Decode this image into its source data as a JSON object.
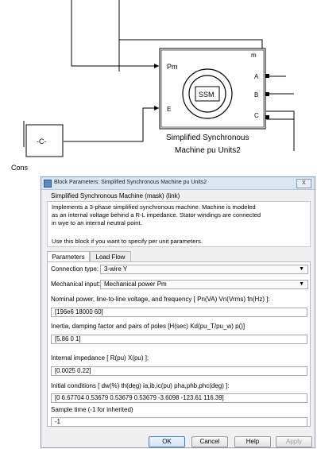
{
  "diagram": {
    "machine_block": {
      "port_labels": {
        "pm": "Pm",
        "e": "E",
        "m": "m",
        "a": "A",
        "b": "B",
        "c": "C"
      },
      "icon_text": "SSM",
      "caption_line1": "Simplified Synchronous",
      "caption_line2": "Machine pu Units2"
    },
    "constant_block": {
      "symbol": "-C-",
      "label": "Cons"
    }
  },
  "dialog": {
    "title": "Block Parameters: Simplified Synchronous Machine pu Units2",
    "close_label": "X",
    "mask_title": "Simplified Synchronous Machine (mask) (link)",
    "description": "Implements a 3-phase simplified synchronous machine. Machine is modeled\nas an internal voltage behind a R-L impedance. Stator windings are connected\nin wye to an internal neutral point.",
    "usage_note": "Use this block if you want to specify per unit parameters.",
    "tabs": [
      {
        "label": "Parameters",
        "active": true
      },
      {
        "label": "Load Flow",
        "active": false
      }
    ],
    "connection_type": {
      "label": "Connection type:",
      "value": "3-wire Y"
    },
    "mechanical_input": {
      "label": "Mechanical input:",
      "value": "Mechanical power Pm"
    },
    "nominal": {
      "label": "Nominal power, line-to-line voltage, and frequency [ Pn(VA) Vn(Vrms) fn(Hz) ]:",
      "value": "[196e6 18000 60]"
    },
    "inertia": {
      "label": "Inertia, damping factor and pairs of poles [H(sec) Kd(pu_T/pu_w) p()]",
      "value": "[5.86 0 1]"
    },
    "impedance": {
      "label": "Internal impedance [ R(pu)  X(pu) ]:",
      "value": "[0.0025 0.22]"
    },
    "initial_conditions": {
      "label": "Initial conditions [ dw(%)  th(deg)  ia,ib,ic(pu)  pha,phb,phc(deg) ]:",
      "value": "[0 6.67704 0.53679 0.53679 0.53679 -3.6098 -123.61 116.39]"
    },
    "sample_time": {
      "label": "Sample time (-1 for inherited)",
      "value": "-1"
    },
    "buttons": {
      "ok": "OK",
      "cancel": "Cancel",
      "help": "Help",
      "apply": "Apply"
    }
  }
}
